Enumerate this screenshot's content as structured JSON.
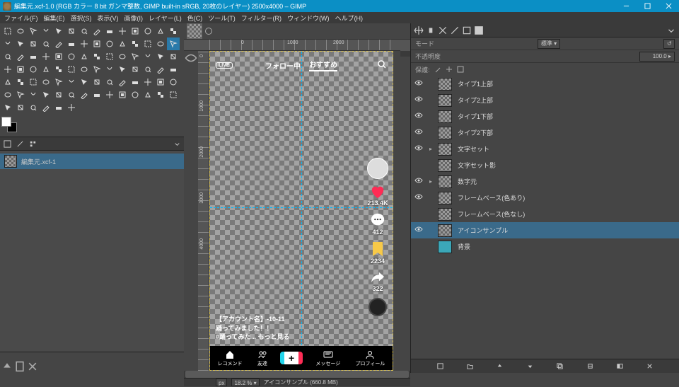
{
  "titlebar": {
    "text": "編集元.xcf-1.0 (RGB カラー 8 bit ガンマ整数, GIMP built-in sRGB, 20枚のレイヤー) 2500x4000 – GIMP"
  },
  "menu": [
    "ファイル(F)",
    "編集(E)",
    "選択(S)",
    "表示(V)",
    "画像(I)",
    "レイヤー(L)",
    "色(C)",
    "ツール(T)",
    "フィルター(R)",
    "ウィンドウ(W)",
    "ヘルプ(H)"
  ],
  "left_thumb": {
    "name": "編集元.xcf-1"
  },
  "ruler_h_ticks": [
    {
      "pos": 45,
      "label": "0"
    },
    {
      "pos": 110,
      "label": "1000"
    },
    {
      "pos": 175,
      "label": "2000"
    }
  ],
  "ruler_v_ticks": [
    {
      "pos": 5,
      "label": "0"
    },
    {
      "pos": 70,
      "label": "1000"
    },
    {
      "pos": 135,
      "label": "2000"
    },
    {
      "pos": 200,
      "label": "3000"
    },
    {
      "pos": 265,
      "label": "4000"
    }
  ],
  "tt": {
    "live": "LIVE",
    "tabs": [
      "フォロー中",
      "おすすめ"
    ],
    "counts": {
      "like": "213.4K",
      "comment": "412",
      "bookmark": "2234",
      "share": "322"
    },
    "caption": [
      "【アカウント名】-10-11",
      "踊ってみました！！",
      "#踊ってみた .. もっと見る"
    ],
    "bottom": [
      "レコメンド",
      "友達",
      "",
      "メッセージ",
      "プロフィール"
    ]
  },
  "statusbar": {
    "unit": "px",
    "zoom": "18.2 %",
    "layer": "アイコンサンプル (660.8 MB)"
  },
  "right": {
    "mode": "モード",
    "mode_val": "標準",
    "opacity": "不透明度",
    "opacity_val": "100.0",
    "lock": "保護:",
    "layers": [
      {
        "name": "タイプ1上部",
        "eye": true
      },
      {
        "name": "タイプ2上部",
        "eye": true
      },
      {
        "name": "タイプ1下部",
        "eye": true
      },
      {
        "name": "タイプ2下部",
        "eye": true
      },
      {
        "name": "文字セット",
        "eye": true,
        "group": true
      },
      {
        "name": "文字セット影"
      },
      {
        "name": "数字元",
        "eye": true,
        "group": true
      },
      {
        "name": "フレームベース(色あり)",
        "eye": true
      },
      {
        "name": "フレームベース(色なし)"
      },
      {
        "name": "アイコンサンプル",
        "eye": true,
        "sel": true
      },
      {
        "name": "背景",
        "solid": true
      }
    ]
  }
}
